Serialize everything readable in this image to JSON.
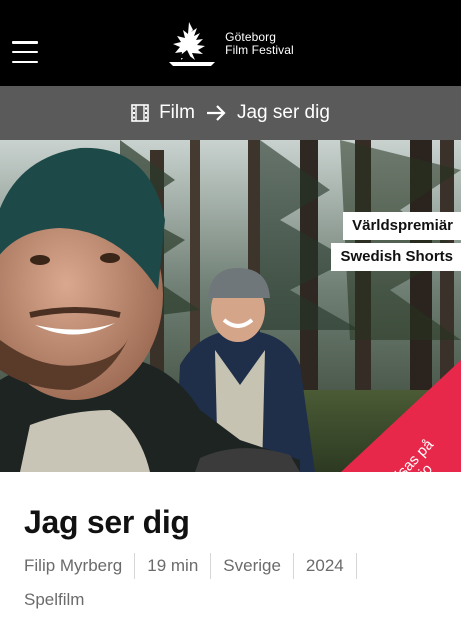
{
  "header": {
    "logo_line1": "Göteborg",
    "logo_line2": "Film Festival",
    "menu_icon": "hamburger-menu-icon",
    "logo_icon": "gff-bird-logo-icon"
  },
  "breadcrumb": {
    "section_icon": "film-strip-icon",
    "section": "Film",
    "separator_icon": "arrow-right-icon",
    "current": "Jag ser dig"
  },
  "hero": {
    "tags": [
      "Världspremiär",
      "Swedish Shorts"
    ],
    "ribbon_line1": "Visas på",
    "ribbon_line2": "bio",
    "ribbon_color": "#e8284a"
  },
  "film": {
    "title": "Jag ser dig",
    "director": "Filip Myrberg",
    "duration": "19 min",
    "country": "Sverige",
    "year": "2024",
    "category": "Spelfilm"
  },
  "colors": {
    "header_bg": "#000000",
    "breadcrumb_bg": "#5a5a5a",
    "accent": "#e8284a",
    "meta_text": "#6b6b6b"
  }
}
